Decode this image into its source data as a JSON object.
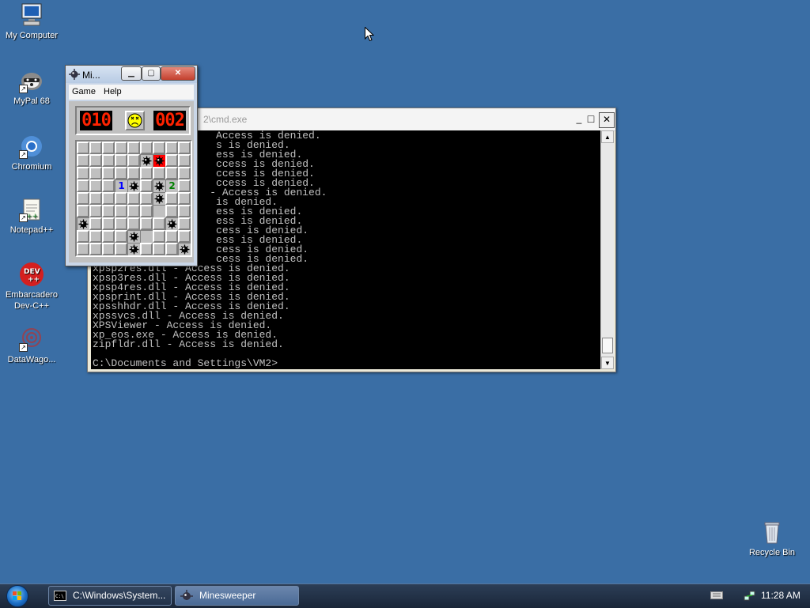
{
  "desktop": {
    "icons": [
      {
        "label": "My Computer",
        "icon": "computer-icon"
      },
      {
        "label": "MyPal 68",
        "icon": "mypal-icon"
      },
      {
        "label": "Chromium",
        "icon": "chromium-icon"
      },
      {
        "label": "Notepad++",
        "icon": "notepadpp-icon"
      },
      {
        "label": "Embarcadero\nDev-C++",
        "icon": "devcpp-icon"
      },
      {
        "label": "DataWago...",
        "icon": "datawagon-icon"
      }
    ],
    "recycle_bin": {
      "label": "Recycle Bin",
      "icon": "recycle-bin-icon"
    }
  },
  "cmd_window": {
    "title": "2\\cmd.exe",
    "controls": {
      "minimize": "_",
      "maximize": "□",
      "close": "✕"
    },
    "lines": [
      "                    Access is denied.",
      "                    s is denied.",
      "                    ess is denied.",
      "                    ccess is denied.",
      "                    ccess is denied.",
      "                    ccess is denied.",
      "                   - Access is denied.",
      "                    is denied.",
      "                    ess is denied.",
      "                    ess is denied.",
      "                    cess is denied.",
      "                    ess is denied.",
      "                    cess is denied.",
      "                    cess is denied.",
      "xpsp2res.dll - Access is denied.",
      "xpsp3res.dll - Access is denied.",
      "xpsp4res.dll - Access is denied.",
      "xpsprint.dll - Access is denied.",
      "xpsshhdr.dll - Access is denied.",
      "xpssvcs.dll - Access is denied.",
      "XPSViewer - Access is denied.",
      "xp_eos.exe - Access is denied.",
      "zipfldr.dll - Access is denied.",
      "",
      "C:\\Documents and Settings\\VM2>"
    ]
  },
  "minesweeper": {
    "title": "Mi...",
    "menu": [
      "Game",
      "Help"
    ],
    "controls": {
      "minimize": "▁",
      "maximize": "▢",
      "close": "✕"
    },
    "mines_left": "010",
    "timer": "002",
    "face_state": "sad",
    "grid_size": 9,
    "hit_mine": [
      6,
      1
    ],
    "mines": [
      [
        5,
        1
      ],
      [
        4,
        3
      ],
      [
        6,
        3
      ],
      [
        6,
        4
      ],
      [
        0,
        6
      ],
      [
        7,
        6
      ],
      [
        4,
        7
      ],
      [
        4,
        8
      ],
      [
        8,
        8
      ]
    ],
    "numbers": [
      {
        "c": 3,
        "r": 3,
        "n": "1",
        "color": "#0000ff"
      },
      {
        "c": 7,
        "r": 3,
        "n": "2",
        "color": "#008000"
      }
    ],
    "open_cells": [
      [
        7,
        3
      ],
      [
        5,
        7
      ],
      [
        6,
        5
      ]
    ]
  },
  "taskbar": {
    "tasks": [
      {
        "label": "C:\\Windows\\System...",
        "icon": "cmd-icon",
        "active": false
      },
      {
        "label": "Minesweeper",
        "icon": "minesweeper-icon",
        "active": true
      }
    ],
    "clock": "11:28 AM"
  },
  "colors": {
    "desktop": "#3a6ea5",
    "lcd_digits": "#ff2200",
    "hit_cell": "#ff0000"
  }
}
